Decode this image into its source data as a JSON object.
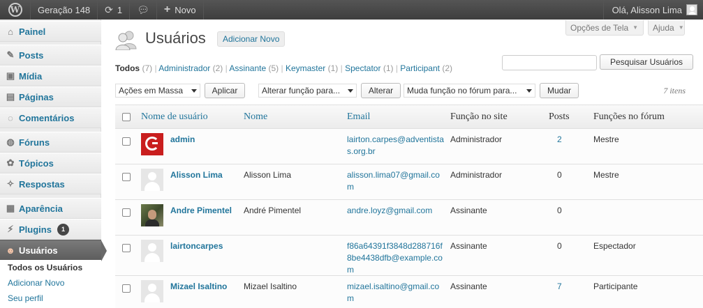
{
  "adminbar": {
    "site_name": "Geração 148",
    "updates_count": "1",
    "new_label": "Novo",
    "greeting": "Olá, Alisson Lima"
  },
  "sidebar": {
    "items": [
      {
        "label": "Painel",
        "icon": "dashboard-icon"
      },
      {
        "label": "Posts",
        "icon": "pin-icon"
      },
      {
        "label": "Mídia",
        "icon": "media-icon"
      },
      {
        "label": "Páginas",
        "icon": "pages-icon"
      },
      {
        "label": "Comentários",
        "icon": "comments-icon"
      },
      {
        "label": "Fóruns",
        "icon": "forums-icon"
      },
      {
        "label": "Tópicos",
        "icon": "topics-icon"
      },
      {
        "label": "Respostas",
        "icon": "replies-icon"
      },
      {
        "label": "Aparência",
        "icon": "appearance-icon"
      },
      {
        "label": "Plugins",
        "icon": "plugins-icon",
        "badge": "1"
      },
      {
        "label": "Usuários",
        "icon": "users-icon"
      }
    ],
    "submenu": [
      "Todos os Usuários",
      "Adicionar Novo",
      "Seu perfil"
    ]
  },
  "screen_options": {
    "screen_label": "Opções de Tela",
    "help_label": "Ajuda"
  },
  "page": {
    "title": "Usuários",
    "add_new": "Adicionar Novo"
  },
  "filters": [
    {
      "label": "Todos",
      "count": "(7)"
    },
    {
      "label": "Administrador",
      "count": "(2)"
    },
    {
      "label": "Assinante",
      "count": "(5)"
    },
    {
      "label": "Keymaster",
      "count": "(1)"
    },
    {
      "label": "Spectator",
      "count": "(1)"
    },
    {
      "label": "Participant",
      "count": "(2)"
    }
  ],
  "search": {
    "button": "Pesquisar Usuários",
    "value": ""
  },
  "bulk": {
    "actions_select": "Ações em Massa",
    "apply": "Aplicar",
    "role_select": "Alterar função para...",
    "change": "Alterar",
    "forum_role_select": "Muda função no fórum para...",
    "forum_change": "Mudar",
    "items_count": "7 itens"
  },
  "table": {
    "headers": {
      "username": "Nome de usuário",
      "name": "Nome",
      "email": "Email",
      "role": "Função no site",
      "posts": "Posts",
      "forum_role": "Funções no fórum"
    },
    "rows": [
      {
        "username": "admin",
        "name": "",
        "email": "lairton.carpes@adventistas.org.br",
        "role": "Administrador",
        "posts": "2",
        "forum_role": "Mestre",
        "avatar": "g-logo"
      },
      {
        "username": "Alisson Lima",
        "name": "Alisson Lima",
        "email": "alisson.lima07@gmail.com",
        "role": "Administrador",
        "posts": "0",
        "forum_role": "Mestre",
        "avatar": "default"
      },
      {
        "username": "Andre Pimentel",
        "name": "André Pimentel",
        "email": "andre.loyz@gmail.com",
        "role": "Assinante",
        "posts": "0",
        "forum_role": "",
        "avatar": "photo"
      },
      {
        "username": "lairtoncarpes",
        "name": "",
        "email": "f86a64391f3848d288716f8be4438dfb@example.com",
        "role": "Assinante",
        "posts": "0",
        "forum_role": "Espectador",
        "avatar": "default"
      },
      {
        "username": "Mizael Isaltino",
        "name": "Mizael Isaltino",
        "email": "mizael.isaltino@gmail.com",
        "role": "Assinante",
        "posts": "7",
        "forum_role": "Participante",
        "avatar": "default"
      }
    ]
  }
}
